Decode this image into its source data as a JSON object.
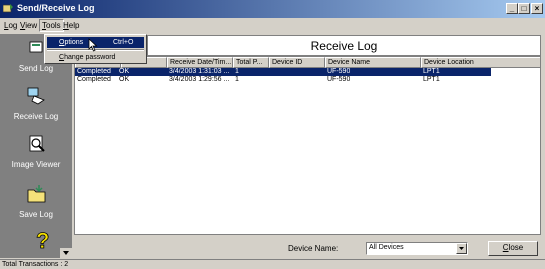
{
  "window": {
    "title": "Send/Receive Log",
    "min": "_",
    "max": "□",
    "close": "×"
  },
  "menu": {
    "items": [
      {
        "key": "L",
        "rest": "og"
      },
      {
        "key": "V",
        "rest": "iew"
      },
      {
        "key": "T",
        "rest": "ools"
      },
      {
        "key": "H",
        "rest": "elp"
      }
    ]
  },
  "tools_menu": {
    "options_key": "O",
    "options_rest": "ptions",
    "options_shortcut": "Ctrl+O",
    "change_key": "C",
    "change_rest": "hange password"
  },
  "sidebar": {
    "items": [
      {
        "label": "Send Log",
        "icon": "send-log-icon"
      },
      {
        "label": "Receive Log",
        "icon": "receive-log-icon"
      },
      {
        "label": "Image Viewer",
        "icon": "image-viewer-icon"
      },
      {
        "label": "Save Log",
        "icon": "save-log-icon"
      }
    ],
    "help_icon": "help-icon"
  },
  "log": {
    "title": "Receive Log",
    "columns": [
      "",
      "",
      "Receive Date/Tim...",
      "Total P...",
      "Device ID",
      "Device Name",
      "Device Location"
    ],
    "rows": [
      {
        "status": "Completed",
        "result": "OK",
        "date": "3/4/2003 1:31:03 ...",
        "pages": "1",
        "device_id": "",
        "device_name": "UF-590",
        "location": "LPT1"
      },
      {
        "status": "Completed",
        "result": "OK",
        "date": "3/4/2003 1:29:56 ...",
        "pages": "1",
        "device_id": "",
        "device_name": "UF-590",
        "location": "LPT1"
      }
    ]
  },
  "filter": {
    "label": "Device Name:",
    "value": "All Devices"
  },
  "close_button": {
    "key": "C",
    "rest": "lose"
  },
  "status": {
    "text": "Total Transactions : 2"
  },
  "colors": {
    "title_start": "#0a246a",
    "title_end": "#a6caf0",
    "selection": "#0a246a",
    "sidebar": "#808080"
  }
}
